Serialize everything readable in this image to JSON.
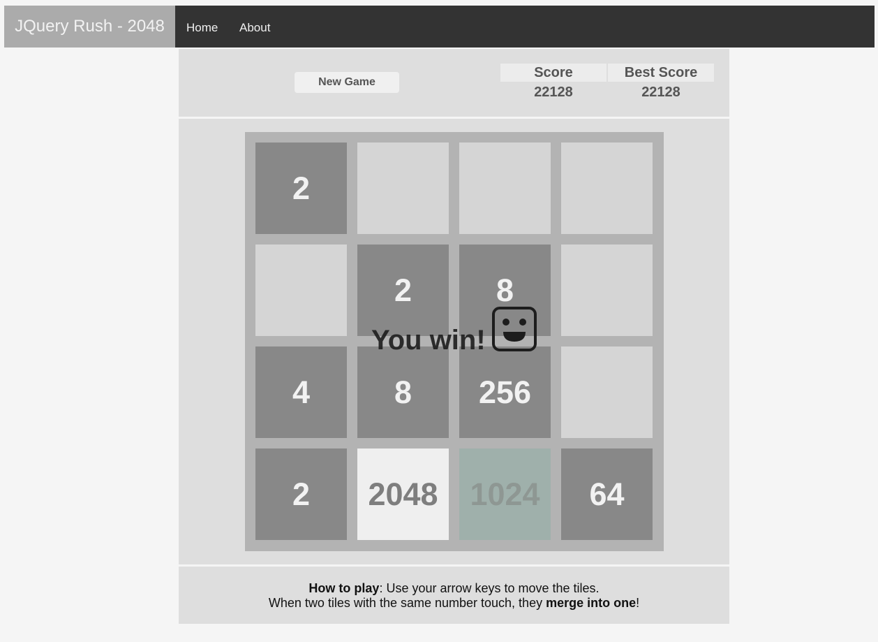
{
  "navbar": {
    "brand": "JQuery Rush - 2048",
    "links": [
      "Home",
      "About"
    ]
  },
  "controls": {
    "new_game_label": "New Game"
  },
  "scores": {
    "score_label": "Score",
    "score_value": "22128",
    "best_label": "Best Score",
    "best_value": "22128"
  },
  "board": {
    "rows": [
      [
        "2",
        "",
        "",
        ""
      ],
      [
        "",
        "2",
        "8",
        ""
      ],
      [
        "4",
        "8",
        "256",
        ""
      ],
      [
        "2",
        "2048",
        "1024",
        "64"
      ]
    ]
  },
  "overlay": {
    "message": "You win!",
    "icon": "smiley-face-icon"
  },
  "instructions": {
    "line1_bold": "How to play",
    "line1_rest": ": Use your arrow keys to move the tiles.",
    "line2_start": "When two tiles with the same number touch, they ",
    "line2_bold": "merge into one",
    "line2_end": "!"
  },
  "colors": {
    "navbar_bg": "#333333",
    "brand_bg": "#ababab",
    "tile_dark": "#888888",
    "tile_2048": "#efefef",
    "tile_1024": "#9fb0ab",
    "empty_cell": "#d5d5d5",
    "grid_bg": "#b3b3b3"
  }
}
